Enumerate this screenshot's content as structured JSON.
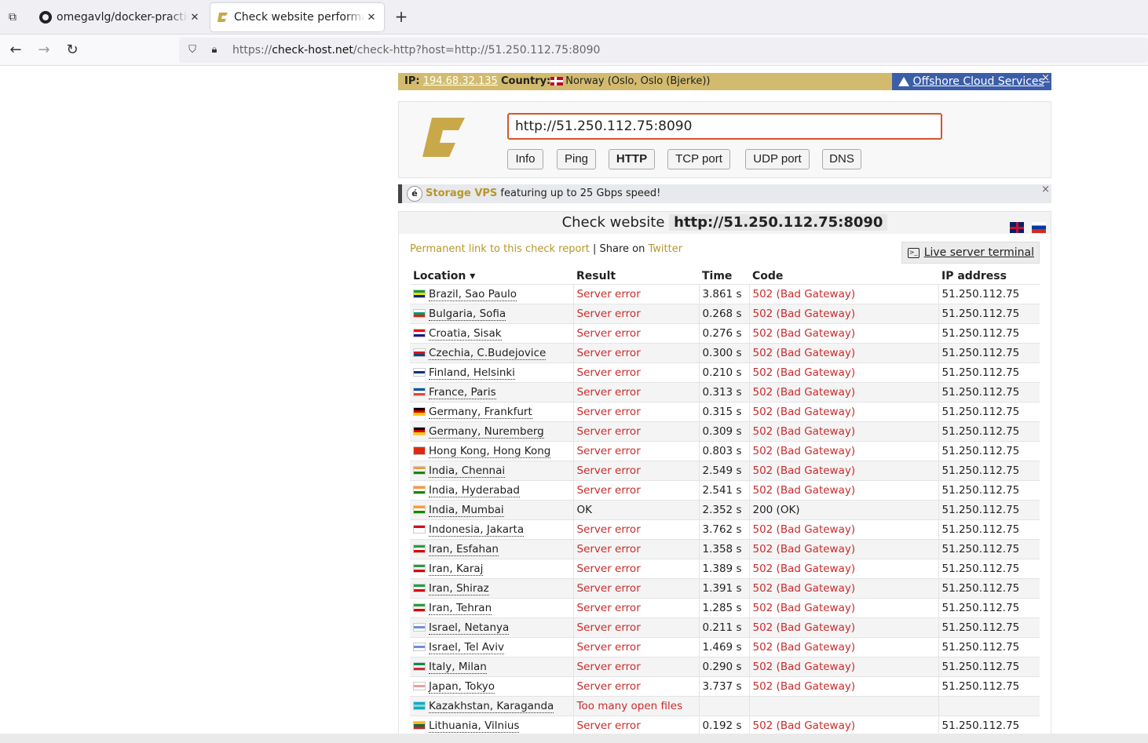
{
  "browser": {
    "tabs": [
      {
        "title": "omegavlg/docker-practice",
        "icon": "github-icon"
      },
      {
        "title": "Check website performance",
        "icon": "check-host-icon"
      }
    ],
    "url_prefix": "https://",
    "url_host": "check-host.net",
    "url_path": "/check-http?host=http://51.250.112.75:8090"
  },
  "ipbar": {
    "ip_label": "IP:",
    "ip": "194.68.32.135",
    "country_label": "Country:",
    "country": "Norway (Oslo, Oslo (Bjerke))",
    "ad": "Offshore Cloud Services",
    "close": "×"
  },
  "search": {
    "value": "http://51.250.112.75:8090",
    "buttons": [
      "Info",
      "Ping",
      "HTTP",
      "TCP port",
      "UDP port",
      "DNS"
    ],
    "active": "HTTP"
  },
  "promo": {
    "badge": "é",
    "highlight": "Storage VPS",
    "text": " featuring up to 25 Gbps speed!",
    "close": "×"
  },
  "result": {
    "title": "Check website",
    "host": "http://51.250.112.75:8090",
    "permalink": "Permanent link to this check report",
    "share_sep": " | Share on ",
    "twitter": "Twitter",
    "terminal": "Live server terminal",
    "columns": [
      "Location ▾",
      "Result",
      "Time",
      "Code",
      "IP address"
    ],
    "rows": [
      {
        "flag": [
          "#009c3b",
          "#ffdf00",
          "#002776"
        ],
        "loc": "Brazil, Sao Paulo",
        "res": "Server error",
        "time": "3.861 s",
        "code": "502 (Bad Gateway)",
        "ip": "51.250.112.75"
      },
      {
        "flag": [
          "#fff",
          "#00966e",
          "#d62612"
        ],
        "loc": "Bulgaria, Sofia",
        "res": "Server error",
        "time": "0.268 s",
        "code": "502 (Bad Gateway)",
        "ip": "51.250.112.75"
      },
      {
        "flag": [
          "#ff0000",
          "#fff",
          "#171796"
        ],
        "loc": "Croatia, Sisak",
        "res": "Server error",
        "time": "0.276 s",
        "code": "502 (Bad Gateway)",
        "ip": "51.250.112.75"
      },
      {
        "flag": [
          "#fff",
          "#d7141a",
          "#11457e"
        ],
        "loc": "Czechia, C.Budejovice",
        "res": "Server error",
        "time": "0.300 s",
        "code": "502 (Bad Gateway)",
        "ip": "51.250.112.75"
      },
      {
        "flag": [
          "#fff",
          "#003580",
          "#fff"
        ],
        "loc": "Finland, Helsinki",
        "res": "Server error",
        "time": "0.210 s",
        "code": "502 (Bad Gateway)",
        "ip": "51.250.112.75"
      },
      {
        "flag": [
          "#0055a4",
          "#fff",
          "#ef4135"
        ],
        "loc": "France, Paris",
        "res": "Server error",
        "time": "0.313 s",
        "code": "502 (Bad Gateway)",
        "ip": "51.250.112.75"
      },
      {
        "flag": [
          "#000",
          "#dd0000",
          "#ffce00"
        ],
        "loc": "Germany, Frankfurt",
        "res": "Server error",
        "time": "0.315 s",
        "code": "502 (Bad Gateway)",
        "ip": "51.250.112.75"
      },
      {
        "flag": [
          "#000",
          "#dd0000",
          "#ffce00"
        ],
        "loc": "Germany, Nuremberg",
        "res": "Server error",
        "time": "0.309 s",
        "code": "502 (Bad Gateway)",
        "ip": "51.250.112.75"
      },
      {
        "flag": [
          "#de2910",
          "#de2910",
          "#de2910"
        ],
        "loc": "Hong Kong, Hong Kong",
        "res": "Server error",
        "time": "0.803 s",
        "code": "502 (Bad Gateway)",
        "ip": "51.250.112.75"
      },
      {
        "flag": [
          "#ff9933",
          "#fff",
          "#138808"
        ],
        "loc": "India, Chennai",
        "res": "Server error",
        "time": "2.549 s",
        "code": "502 (Bad Gateway)",
        "ip": "51.250.112.75"
      },
      {
        "flag": [
          "#ff9933",
          "#fff",
          "#138808"
        ],
        "loc": "India, Hyderabad",
        "res": "Server error",
        "time": "2.541 s",
        "code": "502 (Bad Gateway)",
        "ip": "51.250.112.75"
      },
      {
        "flag": [
          "#ff9933",
          "#fff",
          "#138808"
        ],
        "loc": "India, Mumbai",
        "res": "OK",
        "time": "2.352 s",
        "code": "200 (OK)",
        "ip": "51.250.112.75"
      },
      {
        "flag": [
          "#ce1126",
          "#fff",
          "#fff"
        ],
        "loc": "Indonesia, Jakarta",
        "res": "Server error",
        "time": "3.762 s",
        "code": "502 (Bad Gateway)",
        "ip": "51.250.112.75"
      },
      {
        "flag": [
          "#239f40",
          "#fff",
          "#da0000"
        ],
        "loc": "Iran, Esfahan",
        "res": "Server error",
        "time": "1.358 s",
        "code": "502 (Bad Gateway)",
        "ip": "51.250.112.75"
      },
      {
        "flag": [
          "#239f40",
          "#fff",
          "#da0000"
        ],
        "loc": "Iran, Karaj",
        "res": "Server error",
        "time": "1.389 s",
        "code": "502 (Bad Gateway)",
        "ip": "51.250.112.75"
      },
      {
        "flag": [
          "#239f40",
          "#fff",
          "#da0000"
        ],
        "loc": "Iran, Shiraz",
        "res": "Server error",
        "time": "1.391 s",
        "code": "502 (Bad Gateway)",
        "ip": "51.250.112.75"
      },
      {
        "flag": [
          "#239f40",
          "#fff",
          "#da0000"
        ],
        "loc": "Iran, Tehran",
        "res": "Server error",
        "time": "1.285 s",
        "code": "502 (Bad Gateway)",
        "ip": "51.250.112.75"
      },
      {
        "flag": [
          "#fff",
          "#6f8fd6",
          "#fff"
        ],
        "loc": "Israel, Netanya",
        "res": "Server error",
        "time": "0.211 s",
        "code": "502 (Bad Gateway)",
        "ip": "51.250.112.75"
      },
      {
        "flag": [
          "#fff",
          "#6f8fd6",
          "#fff"
        ],
        "loc": "Israel, Tel Aviv",
        "res": "Server error",
        "time": "1.469 s",
        "code": "502 (Bad Gateway)",
        "ip": "51.250.112.75"
      },
      {
        "flag": [
          "#009246",
          "#fff",
          "#ce2b37"
        ],
        "loc": "Italy, Milan",
        "res": "Server error",
        "time": "0.290 s",
        "code": "502 (Bad Gateway)",
        "ip": "51.250.112.75"
      },
      {
        "flag": [
          "#fff",
          "#e8a0a0",
          "#fff"
        ],
        "loc": "Japan, Tokyo",
        "res": "Server error",
        "time": "3.737 s",
        "code": "502 (Bad Gateway)",
        "ip": "51.250.112.75"
      },
      {
        "flag": [
          "#00afca",
          "#8fd1d8",
          "#00afca"
        ],
        "loc": "Kazakhstan, Karaganda",
        "res": "Too many open files",
        "time": "",
        "code": "",
        "ip": ""
      },
      {
        "flag": [
          "#fdb913",
          "#006a44",
          "#c1272d"
        ],
        "loc": "Lithuania, Vilnius",
        "res": "Server error",
        "time": "0.192 s",
        "code": "502 (Bad Gateway)",
        "ip": "51.250.112.75"
      }
    ]
  }
}
